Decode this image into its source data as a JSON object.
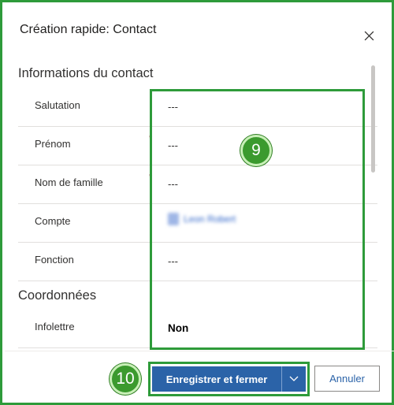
{
  "dialog": {
    "title": "Création rapide: Contact",
    "close_icon": "close-icon"
  },
  "sections": {
    "contact_info": {
      "title": "Informations du contact",
      "fields": [
        {
          "label": "Salutation",
          "value": "---",
          "required": false
        },
        {
          "label": "Prénom",
          "value": "---",
          "required": true
        },
        {
          "label": "Nom de famille",
          "value": "---",
          "required": true
        },
        {
          "label": "Compte",
          "value": "Leon Robert",
          "required": false,
          "lookup_icon": "account-icon",
          "blurred": true
        },
        {
          "label": "Fonction",
          "value": "---",
          "required": false
        }
      ]
    },
    "coordinates": {
      "title": "Coordonnées",
      "fields": [
        {
          "label": "Infolettre",
          "value": "Non",
          "required": false
        }
      ]
    }
  },
  "required_marker": "*",
  "annotations": {
    "badge_fields": "9",
    "badge_save": "10"
  },
  "footer": {
    "save_label": "Enregistrer et fermer",
    "split_icon": "chevron-down-icon",
    "cancel_label": "Annuler"
  },
  "colors": {
    "annotation_green": "#2e9b3a",
    "primary_button": "#2b63a8",
    "required_red": "#a4262c"
  }
}
